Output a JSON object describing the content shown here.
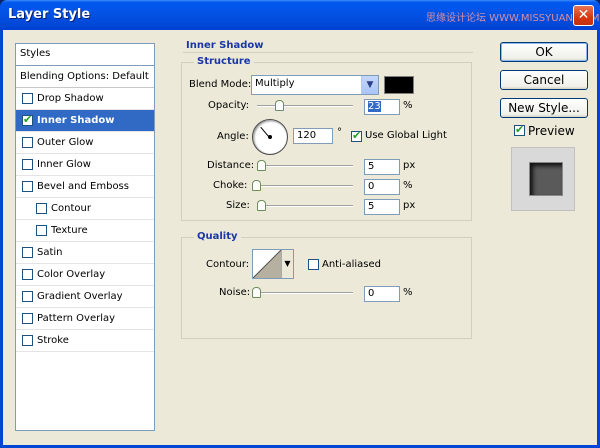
{
  "window": {
    "title": "Layer Style",
    "watermark": "思缘设计论坛 WWW.MISSYUAN.COM",
    "close_glyph": "✕"
  },
  "styles_panel": {
    "header": "Styles",
    "blending_default": "Blending Options: Default",
    "items": [
      {
        "label": "Drop Shadow",
        "checked": false
      },
      {
        "label": "Inner Shadow",
        "checked": true,
        "selected": true
      },
      {
        "label": "Outer Glow",
        "checked": false
      },
      {
        "label": "Inner Glow",
        "checked": false
      },
      {
        "label": "Bevel and Emboss",
        "checked": false
      },
      {
        "label": "Contour",
        "checked": false,
        "indent": true
      },
      {
        "label": "Texture",
        "checked": false,
        "indent": true
      },
      {
        "label": "Satin",
        "checked": false
      },
      {
        "label": "Color Overlay",
        "checked": false
      },
      {
        "label": "Gradient Overlay",
        "checked": false
      },
      {
        "label": "Pattern Overlay",
        "checked": false
      },
      {
        "label": "Stroke",
        "checked": false
      }
    ]
  },
  "inner_shadow": {
    "section_title": "Inner Shadow",
    "structure": {
      "title": "Structure",
      "blend_mode_label": "Blend Mode:",
      "blend_mode_value": "Multiply",
      "shadow_color": "#000000",
      "opacity_label": "Opacity:",
      "opacity_value": "23",
      "opacity_unit": "%",
      "opacity_fraction": 0.23,
      "angle_label": "Angle:",
      "angle_value": "120",
      "angle_unit": "°",
      "use_global_light_label": "Use Global Light",
      "use_global_light_checked": true,
      "distance_label": "Distance:",
      "distance_value": "5",
      "distance_unit": "px",
      "choke_label": "Choke:",
      "choke_value": "0",
      "choke_unit": "%",
      "size_label": "Size:",
      "size_value": "5",
      "size_unit": "px"
    },
    "quality": {
      "title": "Quality",
      "contour_label": "Contour:",
      "anti_aliased_label": "Anti-aliased",
      "anti_aliased_checked": false,
      "noise_label": "Noise:",
      "noise_value": "0",
      "noise_unit": "%"
    }
  },
  "buttons": {
    "ok": "OK",
    "cancel": "Cancel",
    "new_style": "New Style..."
  },
  "preview": {
    "label": "Preview",
    "checked": true
  },
  "colors": {
    "accent": "#316ac5",
    "group_title": "#1a36a8",
    "titlebar": "#0058ee"
  }
}
